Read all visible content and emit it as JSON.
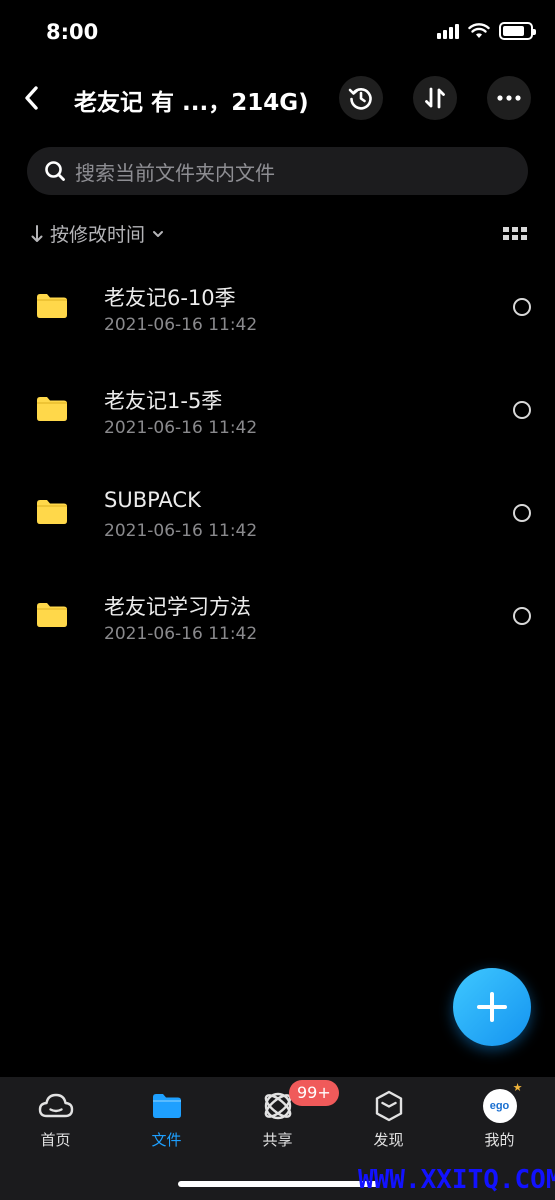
{
  "status_bar": {
    "time": "8:00"
  },
  "header": {
    "title": "老友记 有 ...，214G)"
  },
  "search": {
    "placeholder": "搜索当前文件夹内文件"
  },
  "sort": {
    "label": "按修改时间"
  },
  "files": [
    {
      "name": "老友记6-10季",
      "date": "2021-06-16 11:42",
      "icon": "folder-icon"
    },
    {
      "name": "老友记1-5季",
      "date": "2021-06-16 11:42",
      "icon": "folder-icon"
    },
    {
      "name": "SUBPACK",
      "date": "2021-06-16 11:42",
      "icon": "folder-icon"
    },
    {
      "name": "老友记学习方法",
      "date": "2021-06-16 11:42",
      "icon": "folder-icon"
    }
  ],
  "tabs": [
    {
      "label": "首页",
      "icon": "cloud-icon",
      "active": false
    },
    {
      "label": "文件",
      "icon": "folder-icon",
      "active": true
    },
    {
      "label": "共享",
      "icon": "share-orbit-icon",
      "active": false,
      "badge": "99+"
    },
    {
      "label": "发现",
      "icon": "cube-icon",
      "active": false
    },
    {
      "label": "我的",
      "icon": "avatar",
      "active": false
    }
  ],
  "avatar_logo_text": "ego",
  "watermark": "WWW.XXITQ.COM",
  "colors": {
    "accent": "#1ea0ff",
    "folder": "#ffd84a",
    "badge": "#f05a5a",
    "background": "#000000"
  }
}
